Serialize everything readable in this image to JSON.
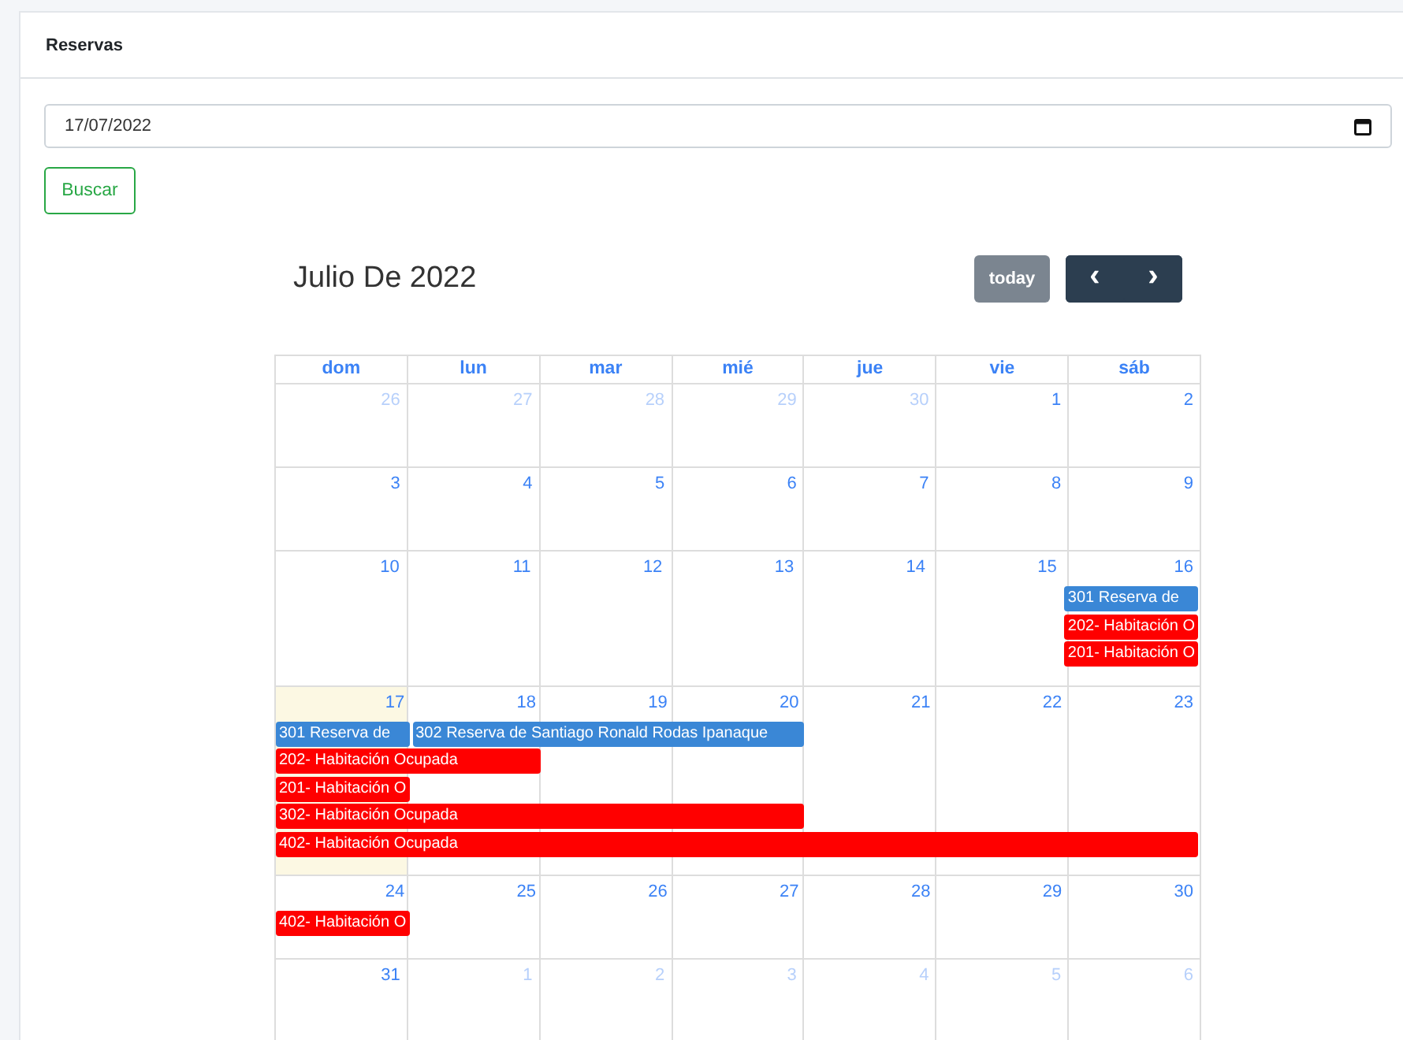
{
  "card": {
    "title": "Reservas"
  },
  "date_field": {
    "value": "17/07/2022"
  },
  "search_button": "Buscar",
  "calendar": {
    "title": "Julio De 2022",
    "today_button": "today",
    "prev_button": "‹",
    "next_button": "›",
    "weekdays": [
      "dom",
      "lun",
      "mar",
      "mié",
      "jue",
      "vie",
      "sáb"
    ],
    "weeks": [
      {
        "days": [
          {
            "number": "26",
            "other_month": true,
            "today": false
          },
          {
            "number": "27",
            "other_month": true,
            "today": false
          },
          {
            "number": "28",
            "other_month": true,
            "today": false
          },
          {
            "number": "29",
            "other_month": true,
            "today": false
          },
          {
            "number": "30",
            "other_month": true,
            "today": false
          },
          {
            "number": "1",
            "other_month": false,
            "today": false
          },
          {
            "number": "2",
            "other_month": false,
            "today": false
          }
        ]
      },
      {
        "days": [
          {
            "number": "3",
            "other_month": false,
            "today": false
          },
          {
            "number": "4",
            "other_month": false,
            "today": false
          },
          {
            "number": "5",
            "other_month": false,
            "today": false
          },
          {
            "number": "6",
            "other_month": false,
            "today": false
          },
          {
            "number": "7",
            "other_month": false,
            "today": false
          },
          {
            "number": "8",
            "other_month": false,
            "today": false
          },
          {
            "number": "9",
            "other_month": false,
            "today": false
          }
        ]
      },
      {
        "days": [
          {
            "number": "10",
            "other_month": false,
            "today": false
          },
          {
            "number": "11",
            "other_month": false,
            "today": false
          },
          {
            "number": "12",
            "other_month": false,
            "today": false
          },
          {
            "number": "13",
            "other_month": false,
            "today": false
          },
          {
            "number": "14",
            "other_month": false,
            "today": false
          },
          {
            "number": "15",
            "other_month": false,
            "today": false
          },
          {
            "number": "16",
            "other_month": false,
            "today": false,
            "events": [
              {
                "kind": "start",
                "text": "301 Reserva de",
                "color": "#3a87d6"
              },
              {
                "kind": "start",
                "text": "202- Habitación O",
                "color": "#ff0000"
              },
              {
                "kind": "start",
                "text": "201- Habitación O",
                "color": "#ff0000"
              }
            ]
          }
        ]
      },
      {
        "days": [
          {
            "number": "17",
            "other_month": false,
            "today": true,
            "events": [
              {
                "kind": "start",
                "text": "301 Reserva de",
                "color": "#3a87d6"
              },
              {
                "kind": "start",
                "text": "202- Habitación Ocupada",
                "color": "#ff0000"
              },
              {
                "kind": "start",
                "text": "201- Habitación O",
                "color": "#ff0000"
              },
              {
                "kind": "start",
                "text": "302- Habitación Ocupada",
                "color": "#ff0000"
              },
              {
                "kind": "start",
                "text": "402- Habitación Ocupada",
                "color": "#ff0000"
              }
            ]
          },
          {
            "number": "18",
            "other_month": false,
            "today": false,
            "events": [
              {
                "kind": "start",
                "text": "302 Reserva de Santiago Ronald Rodas Ipanaque",
                "color": "#3a87d6"
              },
              {
                "kind": "continued"
              },
              {
                "kind": "empty"
              },
              {
                "kind": "continued"
              },
              {
                "kind": "continued"
              }
            ]
          },
          {
            "number": "19",
            "other_month": false,
            "today": false,
            "events": [
              {
                "kind": "continued"
              },
              {
                "kind": "empty"
              },
              {
                "kind": "empty"
              },
              {
                "kind": "continued"
              },
              {
                "kind": "continued"
              }
            ]
          },
          {
            "number": "20",
            "other_month": false,
            "today": false,
            "events": [
              {
                "kind": "continued"
              },
              {
                "kind": "empty"
              },
              {
                "kind": "empty"
              },
              {
                "kind": "continued"
              },
              {
                "kind": "continued"
              }
            ]
          },
          {
            "number": "21",
            "other_month": false,
            "today": false,
            "events": [
              {
                "kind": "empty"
              },
              {
                "kind": "empty"
              },
              {
                "kind": "empty"
              },
              {
                "kind": "empty"
              },
              {
                "kind": "continued"
              }
            ]
          },
          {
            "number": "22",
            "other_month": false,
            "today": false,
            "events": [
              {
                "kind": "empty"
              },
              {
                "kind": "empty"
              },
              {
                "kind": "empty"
              },
              {
                "kind": "empty"
              },
              {
                "kind": "continued"
              }
            ]
          },
          {
            "number": "23",
            "other_month": false,
            "today": false,
            "events": [
              {
                "kind": "empty"
              },
              {
                "kind": "empty"
              },
              {
                "kind": "empty"
              },
              {
                "kind": "empty"
              },
              {
                "kind": "continued"
              }
            ]
          }
        ]
      },
      {
        "days": [
          {
            "number": "24",
            "other_month": false,
            "today": false,
            "events": [
              {
                "kind": "start",
                "text": "402- Habitación O",
                "color": "#ff0000"
              }
            ]
          },
          {
            "number": "25",
            "other_month": false,
            "today": false
          },
          {
            "number": "26",
            "other_month": false,
            "today": false
          },
          {
            "number": "27",
            "other_month": false,
            "today": false
          },
          {
            "number": "28",
            "other_month": false,
            "today": false
          },
          {
            "number": "29",
            "other_month": false,
            "today": false
          },
          {
            "number": "30",
            "other_month": false,
            "today": false
          }
        ]
      },
      {
        "days": [
          {
            "number": "31",
            "other_month": false,
            "today": false
          },
          {
            "number": "1",
            "other_month": true,
            "today": false
          },
          {
            "number": "2",
            "other_month": true,
            "today": false
          },
          {
            "number": "3",
            "other_month": true,
            "today": false
          },
          {
            "number": "4",
            "other_month": true,
            "today": false
          },
          {
            "number": "5",
            "other_month": true,
            "today": false
          },
          {
            "number": "6",
            "other_month": true,
            "today": false
          }
        ]
      }
    ]
  }
}
